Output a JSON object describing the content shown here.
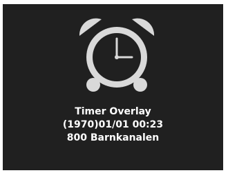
{
  "overlay": {
    "icon": "alarm-clock-icon",
    "title": "Timer Overlay",
    "datetime": "(1970)01/01 00:23",
    "channel": "800 Barnkanalen"
  },
  "colors": {
    "background": "#202020",
    "icon": "#d9d9d9",
    "text": "#ffffff"
  }
}
